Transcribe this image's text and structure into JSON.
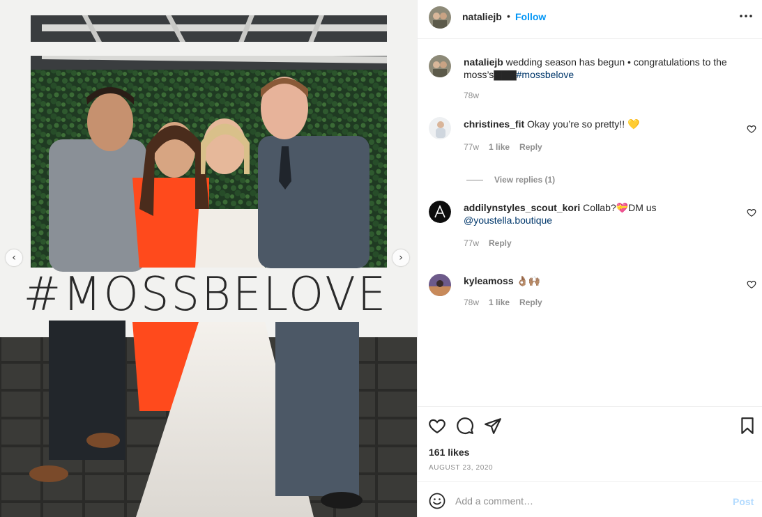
{
  "photo": {
    "caption_sign": "#MOSSBELOVE",
    "carousel_prev": "‹",
    "carousel_next": "›"
  },
  "header": {
    "username": "nataliejb",
    "separator": "•",
    "follow_label": "Follow",
    "more_icon": "more-dots-icon"
  },
  "caption": {
    "username": "nataliejb",
    "text": " wedding season has begun • congratulations to the moss’s",
    "marks": "▇▇▇",
    "hashtag": "#mossbelove",
    "time": "78w"
  },
  "comments": [
    {
      "username": "christines_fit",
      "text": " Okay you’re so pretty!! 💛",
      "time": "77w",
      "likes": "1 like",
      "reply": "Reply"
    },
    {
      "username": "addilynstyles_scout_kori",
      "text": " Collab?💝DM us ",
      "mention": "@youstella.boutique",
      "time": "77w",
      "reply": "Reply"
    },
    {
      "username": "kyleamoss",
      "text": " 👌🏽🙌🏽",
      "time": "78w",
      "likes": "1 like",
      "reply": "Reply"
    }
  ],
  "view_replies": "View replies (1)",
  "actions": {
    "like_icon": "heart-icon",
    "comment_icon": "comment-icon",
    "share_icon": "send-icon",
    "save_icon": "bookmark-icon",
    "likes": "161 likes",
    "date": "AUGUST 23, 2020"
  },
  "add_comment": {
    "placeholder": "Add a comment…",
    "post_label": "Post",
    "emoji_icon": "smiley-icon"
  },
  "colors": {
    "link_blue": "#0095f6",
    "hashtag_blue": "#00376b",
    "muted_gray": "#8e8e8e",
    "post_disabled": "#b3dbff"
  }
}
